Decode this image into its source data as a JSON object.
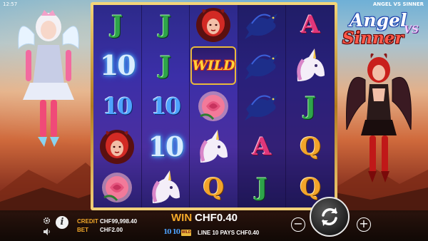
{
  "status": {
    "time": "12:57",
    "game_title": "ANGEL VS SINNER"
  },
  "logo": {
    "angel": "Angel",
    "vs": "VS",
    "sinner": "Sinner"
  },
  "reels": [
    [
      "J",
      "10",
      "10",
      "devil",
      "rose"
    ],
    [
      "J",
      "J",
      "10",
      "10",
      "unicorn"
    ],
    [
      "devil",
      "WILD",
      "rose",
      "unicorn",
      "Q"
    ],
    [
      "raven",
      "raven",
      "raven",
      "A",
      "J"
    ],
    [
      "A",
      "unicorn",
      "J",
      "Q",
      "Q"
    ]
  ],
  "wild_label": "WILD",
  "footer": {
    "credit_label": "CREDIT",
    "credit_value": "CHF99,998.40",
    "bet_label": "BET",
    "bet_value": "CHF2.00",
    "win_label": "WIN",
    "win_value": "CHF0.40",
    "payline_symbols": [
      "10",
      "10",
      "WILD"
    ],
    "line_info": "LINE 10 PAYS CHF0.40",
    "info_label": "i",
    "minus_label": "−",
    "plus_label": "+"
  },
  "colors": {
    "gold": "#f3a92a",
    "frame_gold": "#e9b93c",
    "reel_bg": "#3b2fa8"
  },
  "icons": {
    "settings": "gear-icon",
    "info": "info-icon",
    "sound": "speaker-icon",
    "spin": "spin-arrows-icon"
  }
}
